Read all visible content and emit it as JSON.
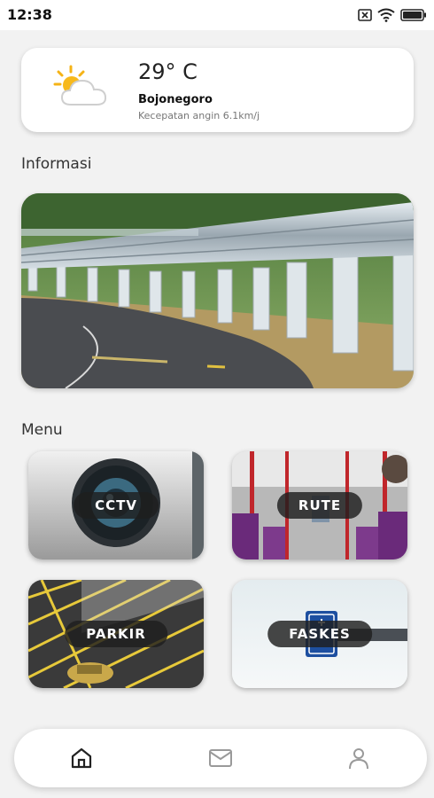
{
  "status_bar": {
    "time": "12:38",
    "icons": [
      "notification-x-icon",
      "wifi-icon",
      "battery-icon"
    ]
  },
  "weather": {
    "temperature": "29° C",
    "city": "Bojonegoro",
    "wind": "Kecepatan angin 6.1km/j",
    "icon": "partly-cloudy-icon"
  },
  "sections": {
    "info_title": "Informasi",
    "menu_title": "Menu"
  },
  "menu": {
    "items": [
      {
        "label": "CCTV"
      },
      {
        "label": "RUTE"
      },
      {
        "label": "PARKIR"
      },
      {
        "label": "FASKES"
      }
    ]
  },
  "bottom_nav": {
    "items": [
      "home-icon",
      "mail-icon",
      "profile-icon"
    ],
    "active": "home-icon"
  },
  "colors": {
    "background": "#f2f2f2",
    "card": "#ffffff",
    "pill": "#1e1e1e"
  }
}
